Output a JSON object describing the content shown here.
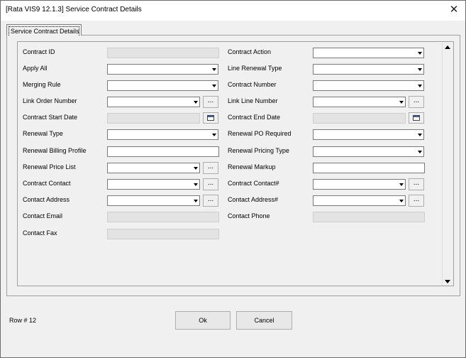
{
  "window": {
    "title": "[Rata VIS9 12.1.3] Service Contract Details",
    "close_label": "✕"
  },
  "tab": {
    "label": "Service Contract Details"
  },
  "left": {
    "contract_id": "Contract ID",
    "apply_all": "Apply All",
    "merging_rule": "Merging Rule",
    "link_order_number": "Link Order Number",
    "contract_start_date": "Contract Start Date",
    "renewal_type": "Renewal Type",
    "renewal_billing_profile": "Renewal Billing Profile",
    "renewal_price_list": "Renewal Price List",
    "contract_contact": "Contract Contact",
    "contact_address": "Contact Address",
    "contact_email": "Contact Email",
    "contact_fax": "Contact Fax"
  },
  "right": {
    "contract_action": "Contract Action",
    "line_renewal_type": "Line Renewal Type",
    "contract_number": "Contract Number",
    "link_line_number": "Link Line Number",
    "contract_end_date": "Contract End Date",
    "renewal_po_required": "Renewal PO Required",
    "renewal_pricing_type": "Renewal Pricing Type",
    "renewal_markup": "Renewal Markup",
    "contract_contact_no": "Contract Contact#",
    "contact_address_no": "Contact Address#",
    "contact_phone": "Contact Phone"
  },
  "lookup_label": "...",
  "footer": {
    "row_info": "Row # 12",
    "ok_label": "Ok",
    "cancel_label": "Cancel"
  }
}
